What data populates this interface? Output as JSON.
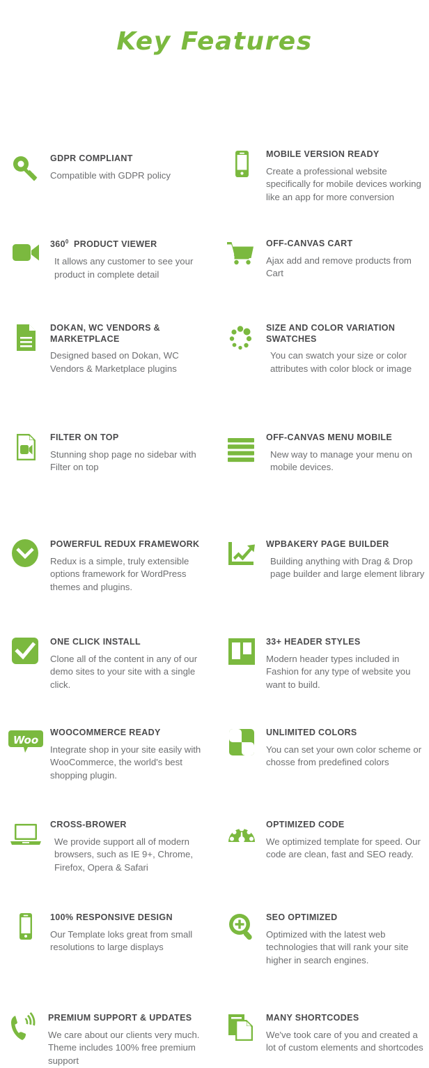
{
  "page": {
    "title": "Key Features",
    "accent_color": "#7bb93f",
    "title_color": "#7bb93f",
    "heading_color": "#4a4a4c",
    "body_color": "#6d6e70",
    "background_color": "#ffffff"
  },
  "features": [
    {
      "id": "gdpr-compliant",
      "icon": "key-icon",
      "title": "GDPR COMPLIANT",
      "desc": "Compatible with GDPR policy"
    },
    {
      "id": "mobile-version-ready",
      "icon": "mobile-phone-icon",
      "title": "MOBILE VERSION READY",
      "desc": "Create a professional website specifically for mobile devices working like an app for more conversion"
    },
    {
      "id": "360-product-viewer",
      "icon": "video-camera-icon",
      "title_prefix": "360",
      "title_sup": "0",
      "title": "360⁰  PRODUCT VIEWER",
      "title_rest": "PRODUCT VIEWER",
      "desc": "It allows any customer to see your product in complete detail"
    },
    {
      "id": "off-canvas-cart",
      "icon": "shopping-cart-icon",
      "title": "OFF-CANVAS CART",
      "desc": "Ajax add and remove products from Cart"
    },
    {
      "id": "dokan-wc-vendors-marketplace",
      "icon": "document-lines-icon",
      "title": "DOKAN, WC VENDORS & MARKETPLACE",
      "desc": "Designed based on Dokan, WC Vendors & Marketplace plugins"
    },
    {
      "id": "size-and-color-variation-swatches",
      "icon": "dot-spinner-icon",
      "title": "SIZE AND COLOR VARIATION SWATCHES",
      "desc": "You can swatch your size or color attributes with color block or image"
    },
    {
      "id": "filter-on-top",
      "icon": "video-document-icon",
      "title": "FILTER ON TOP",
      "desc": "Stunning shop page no sidebar with Filter on top"
    },
    {
      "id": "off-canvas-menu-mobile",
      "icon": "hamburger-menu-icon",
      "title": "OFF-CANVAS MENU MOBILE",
      "desc": "New way to manage your menu on mobile devices."
    },
    {
      "id": "powerful-redux-framework",
      "icon": "chevron-down-circle-icon",
      "title": "POWERFUL REDUX FRAMEWORK",
      "desc": "Redux is a simple, truly extensible options framework for WordPress themes and plugins."
    },
    {
      "id": "wpbakery-page-builder",
      "icon": "growth-chart-icon",
      "title": "WPBAKERY PAGE BUILDER",
      "desc": "Building anything with Drag & Drop page builder and large element library"
    },
    {
      "id": "one-click-install",
      "icon": "check-square-icon",
      "title": "ONE CLICK INSTALL",
      "desc": "Clone all of the content in any of our demo sites to your site with a single click."
    },
    {
      "id": "header-styles",
      "icon": "layout-columns-icon",
      "title": "33+ HEADER STYLES",
      "desc": "Modern header types included in Fashion for any type of website you want to build."
    },
    {
      "id": "woocommerce-ready",
      "icon": "woo-bubble-icon",
      "title": "WOOCOMMERCE READY",
      "desc": "Integrate shop in your site easily with WooCommerce, the world's best shopping plugin."
    },
    {
      "id": "unlimited-colors",
      "icon": "checkerboard-icon",
      "title": "UNLIMITED COLORS",
      "desc": "You can set your own color scheme or chosse from predefined colors"
    },
    {
      "id": "cross-brower",
      "icon": "laptop-icon",
      "title": "CROSS-BROWER",
      "desc": "We provide support all of modern browsers, such as IE 9+, Chrome, Firefox, Opera & Safari"
    },
    {
      "id": "optimized-code",
      "icon": "speedometer-icon",
      "title": "OPTIMIZED CODE",
      "desc": "We optimized template for speed. Our code are clean, fast and SEO ready."
    },
    {
      "id": "responsive-design",
      "icon": "smartphone-icon",
      "title": "100% RESPONSIVE DESIGN",
      "desc": "Our Template loks great from small resolutions to large displays"
    },
    {
      "id": "seo-optimized",
      "icon": "magnifier-plus-icon",
      "title": "SEO OPTIMIZED",
      "desc": "Optimized with the latest web technologies that will rank your site higher in search engines."
    },
    {
      "id": "premium-support-updates",
      "icon": "ringing-phone-icon",
      "title": "PREMIUM SUPPORT & UPDATES",
      "desc": "We care about our clients very much. Theme includes 100% free premium support"
    },
    {
      "id": "many-shortcodes",
      "icon": "copy-documents-icon",
      "title": "MANY SHORTCODES",
      "desc": "We've took care of you and created a lot of custom elements and shortcodes"
    }
  ]
}
